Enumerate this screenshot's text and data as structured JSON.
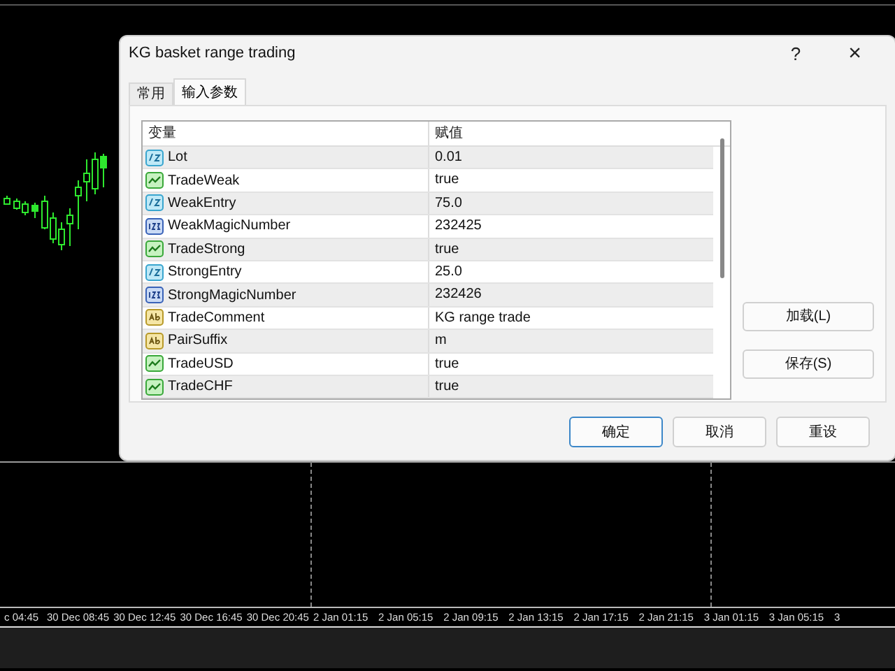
{
  "chart": {
    "time_axis": [
      "c 04:45",
      "30 Dec 08:45",
      "30 Dec 12:45",
      "30 Dec 16:45",
      "30 Dec 20:45",
      "2 Jan 01:15",
      "2 Jan 05:15",
      "2 Jan 09:15",
      "2 Jan 13:15",
      "2 Jan 17:15",
      "2 Jan 21:15",
      "3 Jan 01:15",
      "3 Jan 05:15",
      "3"
    ]
  },
  "dialog": {
    "title": "KG basket range trading",
    "help": "?",
    "close": "×",
    "tabs": [
      {
        "label": "常用",
        "selected": false
      },
      {
        "label": "输入参数",
        "selected": true
      }
    ],
    "table": {
      "columns": [
        "变量",
        "赋值"
      ],
      "rows": [
        {
          "kind": "double",
          "name": "Lot",
          "value": "0.01"
        },
        {
          "kind": "bool",
          "name": "TradeWeak",
          "value": "true"
        },
        {
          "kind": "double",
          "name": "WeakEntry",
          "value": "75.0"
        },
        {
          "kind": "int",
          "name": "WeakMagicNumber",
          "value": "232425"
        },
        {
          "kind": "bool",
          "name": "TradeStrong",
          "value": "true"
        },
        {
          "kind": "double",
          "name": "StrongEntry",
          "value": "25.0"
        },
        {
          "kind": "int",
          "name": "StrongMagicNumber",
          "value": "232426"
        },
        {
          "kind": "string",
          "name": "TradeComment",
          "value": "KG range trade"
        },
        {
          "kind": "string",
          "name": "PairSuffix",
          "value": "m"
        },
        {
          "kind": "bool",
          "name": "TradeUSD",
          "value": "true"
        },
        {
          "kind": "bool",
          "name": "TradeCHF",
          "value": "true"
        }
      ]
    },
    "side_buttons": [
      {
        "label": "加载(L)"
      },
      {
        "label": "保存(S)"
      }
    ],
    "buttons": [
      {
        "label": "确定",
        "default": true
      },
      {
        "label": "取消",
        "default": false
      },
      {
        "label": "重设",
        "default": false
      }
    ]
  }
}
